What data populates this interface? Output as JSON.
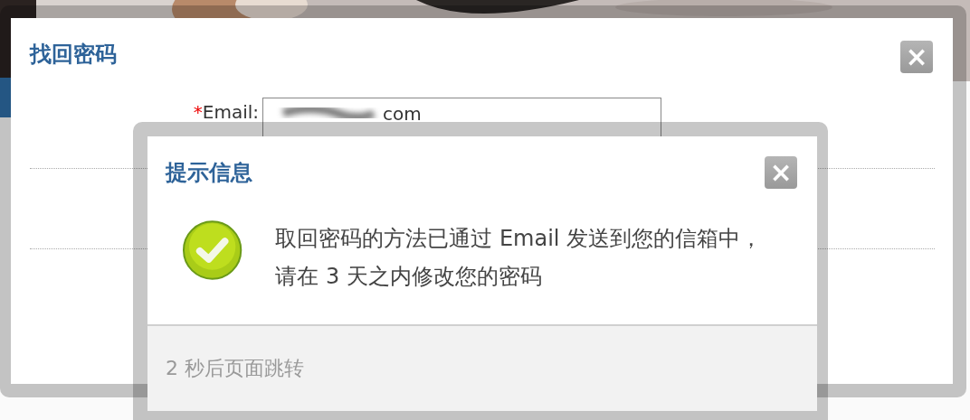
{
  "find_password_dialog": {
    "title": "找回密码",
    "close": "×",
    "email_field": {
      "required_mark": "*",
      "label": "Email:",
      "value": "com",
      "redacted": true
    }
  },
  "message_dialog": {
    "title": "提示信息",
    "close": "×",
    "kind": "success",
    "message": "取回密码的方法已通过 Email 发送到您的信箱中，请在 3 天之内修改您的密码",
    "footer": "2 秒后页面跳转"
  }
}
